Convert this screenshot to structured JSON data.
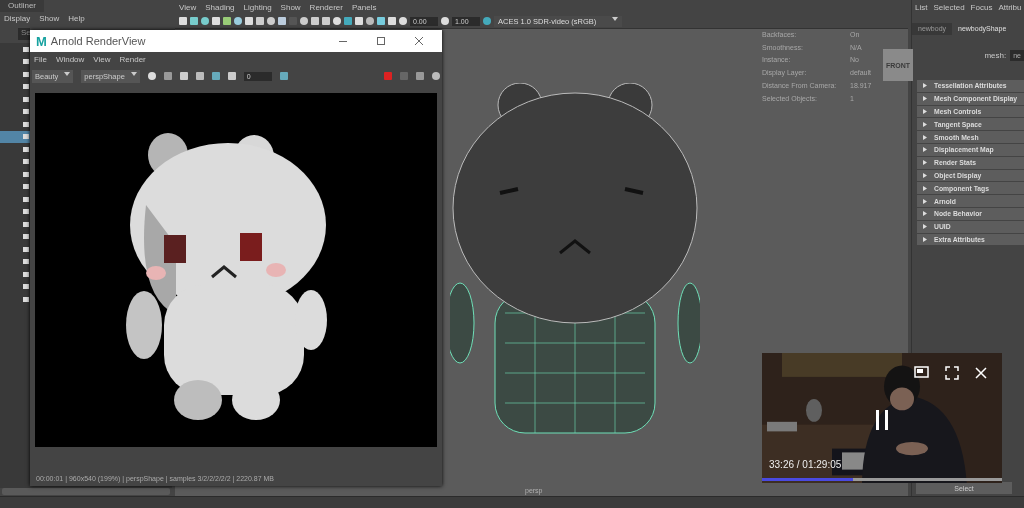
{
  "outliner": {
    "title": "Outliner",
    "menu": [
      "Display",
      "Show",
      "Help"
    ],
    "search_placeholder": "Se",
    "rows": [
      {
        "selected": false
      },
      {
        "selected": false
      },
      {
        "selected": false
      },
      {
        "selected": false
      },
      {
        "selected": false
      },
      {
        "selected": false
      },
      {
        "selected": false
      },
      {
        "selected": true
      },
      {
        "selected": false
      },
      {
        "selected": false
      },
      {
        "selected": false
      },
      {
        "selected": false
      },
      {
        "selected": false
      },
      {
        "selected": false
      },
      {
        "selected": false
      },
      {
        "selected": false
      },
      {
        "selected": false
      },
      {
        "selected": false
      },
      {
        "selected": false
      },
      {
        "selected": false
      },
      {
        "selected": false
      }
    ]
  },
  "viewport": {
    "menu": [
      "View",
      "Shading",
      "Lighting",
      "Show",
      "Renderer",
      "Panels"
    ],
    "exposure": "0.00",
    "gamma": "1.00",
    "color_space": "ACES 1.0 SDR-video (sRGB)",
    "hud": [
      {
        "label": "Backfaces:",
        "value": "On"
      },
      {
        "label": "Smoothness:",
        "value": "N/A"
      },
      {
        "label": "Instance:",
        "value": "No"
      },
      {
        "label": "Display Layer:",
        "value": "default"
      },
      {
        "label": "Distance From Camera:",
        "value": "18.917"
      },
      {
        "label": "Selected Objects:",
        "value": "1"
      }
    ],
    "view_cube": "FRONT",
    "camera": "persp"
  },
  "attribute_editor": {
    "menu": [
      "List",
      "Selected",
      "Focus",
      "Attribu"
    ],
    "tabs": [
      {
        "label": "newbody",
        "selected": false
      },
      {
        "label": "newbodyShape",
        "selected": true
      }
    ],
    "mesh_label": "mesh:",
    "mesh_value": "ne",
    "sections": [
      "Tessellation Attributes",
      "Mesh Component Display",
      "Mesh Controls",
      "Tangent Space",
      "Smooth Mesh",
      "Displacement Map",
      "Render Stats",
      "Object Display",
      "Component Tags",
      "Arnold",
      "Node Behavior",
      "UUID",
      "Extra Attributes"
    ],
    "select_button": "Select"
  },
  "render_view": {
    "logo": "M",
    "title": "Arnold RenderView",
    "menu": [
      "File",
      "Window",
      "View",
      "Render"
    ],
    "aov": "Beauty",
    "camera": "perspShape",
    "frame_value": "0",
    "status": "00:00:01 | 960x540 (199%) | perspShape  | samples 3/2/2/2/2/2 | 2220.87 MB"
  },
  "video": {
    "playing": true,
    "time": "33:26 / 01:29:05",
    "level": 0.38
  }
}
